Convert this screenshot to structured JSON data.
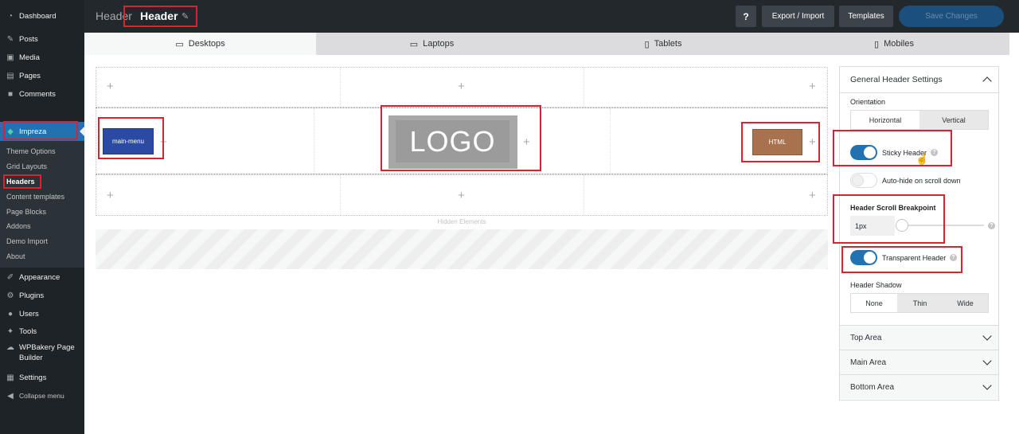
{
  "sidebar": {
    "items": [
      {
        "label": "Dashboard",
        "icon": "dashboard-icon"
      },
      {
        "label": "Posts",
        "icon": "pin-icon"
      },
      {
        "label": "Media",
        "icon": "media-icon"
      },
      {
        "label": "Pages",
        "icon": "page-icon"
      },
      {
        "label": "Comments",
        "icon": "comment-icon"
      },
      {
        "label": "Impreza",
        "icon": "impreza-icon"
      },
      {
        "label": "Appearance",
        "icon": "brush-icon"
      },
      {
        "label": "Plugins",
        "icon": "plugin-icon"
      },
      {
        "label": "Users",
        "icon": "user-icon"
      },
      {
        "label": "Tools",
        "icon": "wrench-icon"
      },
      {
        "label": "WPBakery Page Builder",
        "icon": "wpbakery-icon"
      },
      {
        "label": "Settings",
        "icon": "settings-icon"
      },
      {
        "label": "Collapse menu",
        "icon": "collapse-icon"
      }
    ],
    "submenu": [
      "Theme Options",
      "Grid Layouts",
      "Headers",
      "Content templates",
      "Page Blocks",
      "Addons",
      "Demo Import",
      "About"
    ]
  },
  "topbar": {
    "crumb": "Header",
    "title": "Header",
    "help_label": "?",
    "export_label": "Export / Import",
    "templates_label": "Templates",
    "save_label": "Save Changes"
  },
  "device_tabs": [
    "Desktops",
    "Laptops",
    "Tablets",
    "Mobiles"
  ],
  "builder": {
    "main_menu_label": "main-menu",
    "logo_label": "LOGO",
    "html_label": "HTML",
    "hidden_label": "Hidden Elements",
    "plus": "+"
  },
  "panel": {
    "title": "General Header Settings",
    "orientation_label": "Orientation",
    "orientation_options": [
      "Horizontal",
      "Vertical"
    ],
    "orientation_selected": "Horizontal",
    "sticky_label": "Sticky Header",
    "sticky_on": true,
    "autohide_label": "Auto-hide on scroll down",
    "autohide_on": false,
    "breakpoint_label": "Header Scroll Breakpoint",
    "breakpoint_value": "1px",
    "transparent_label": "Transparent Header",
    "transparent_on": true,
    "shadow_label": "Header Shadow",
    "shadow_options": [
      "None",
      "Thin",
      "Wide"
    ],
    "shadow_selected": "None",
    "sections": [
      "Top Area",
      "Main Area",
      "Bottom Area"
    ]
  },
  "colors": {
    "accent": "#2271b1",
    "highlight_box": "#d9242f",
    "main_menu_bg": "#2b4aa3",
    "html_bg": "#a8724f",
    "logo_bg": "#a7a7a7"
  }
}
